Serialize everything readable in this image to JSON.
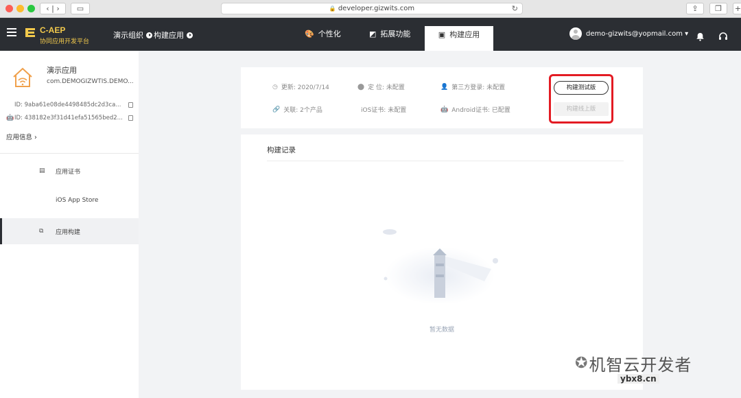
{
  "browser": {
    "url": "developer.gizwits.com",
    "back_icon": "chevron-left-icon",
    "forward_icon": "chevron-right-icon"
  },
  "topnav": {
    "brand": "C-AEP",
    "brand_sub": "协同应用开发平台",
    "breadcrumb": [
      "演示组织",
      "构建应用"
    ],
    "tabs": [
      {
        "label": "个性化",
        "icon": "palette-icon"
      },
      {
        "label": "拓展功能",
        "icon": "puzzle-icon"
      },
      {
        "label": "构建应用",
        "icon": "build-icon",
        "active": true
      }
    ],
    "user_email": "demo-gizwits@yopmail.com ▾",
    "accent": "#f2c94c",
    "bg": "#2b2e33"
  },
  "sidebar": {
    "app_name": "演示应用",
    "app_package": "com.DEMOGIZWTIS.DEMO...",
    "ids": [
      {
        "os": "ios",
        "label": "ID:",
        "value": "9aba61e08de4498485dc2d3ca..."
      },
      {
        "os": "android",
        "label": "ID:",
        "value": "438182e3f31d41efa51565bed2..."
      }
    ],
    "app_info": "应用信息",
    "items": [
      {
        "label": "应用证书",
        "icon": "certificate-icon"
      },
      {
        "label": "iOS App Store",
        "icon": "apple-icon"
      },
      {
        "label": "应用构建",
        "icon": "copy-icon",
        "active": true
      }
    ]
  },
  "info": {
    "updated": "更新: 2020/7/14",
    "location": "定 位: 未配置",
    "third_login": "第三方登录: 未配置",
    "linked": "关联: 2个产品",
    "ios_cert": "iOS证书: 未配置",
    "android_cert": "Android证书: 已配置",
    "btn_test": "构建测试版",
    "btn_online": "构建线上版",
    "highlight_color": "#e31b23"
  },
  "records": {
    "title": "构建记录",
    "empty": "暂无数据"
  },
  "watermark": {
    "text": "机智云开发者",
    "site": "ybx8.cn"
  }
}
